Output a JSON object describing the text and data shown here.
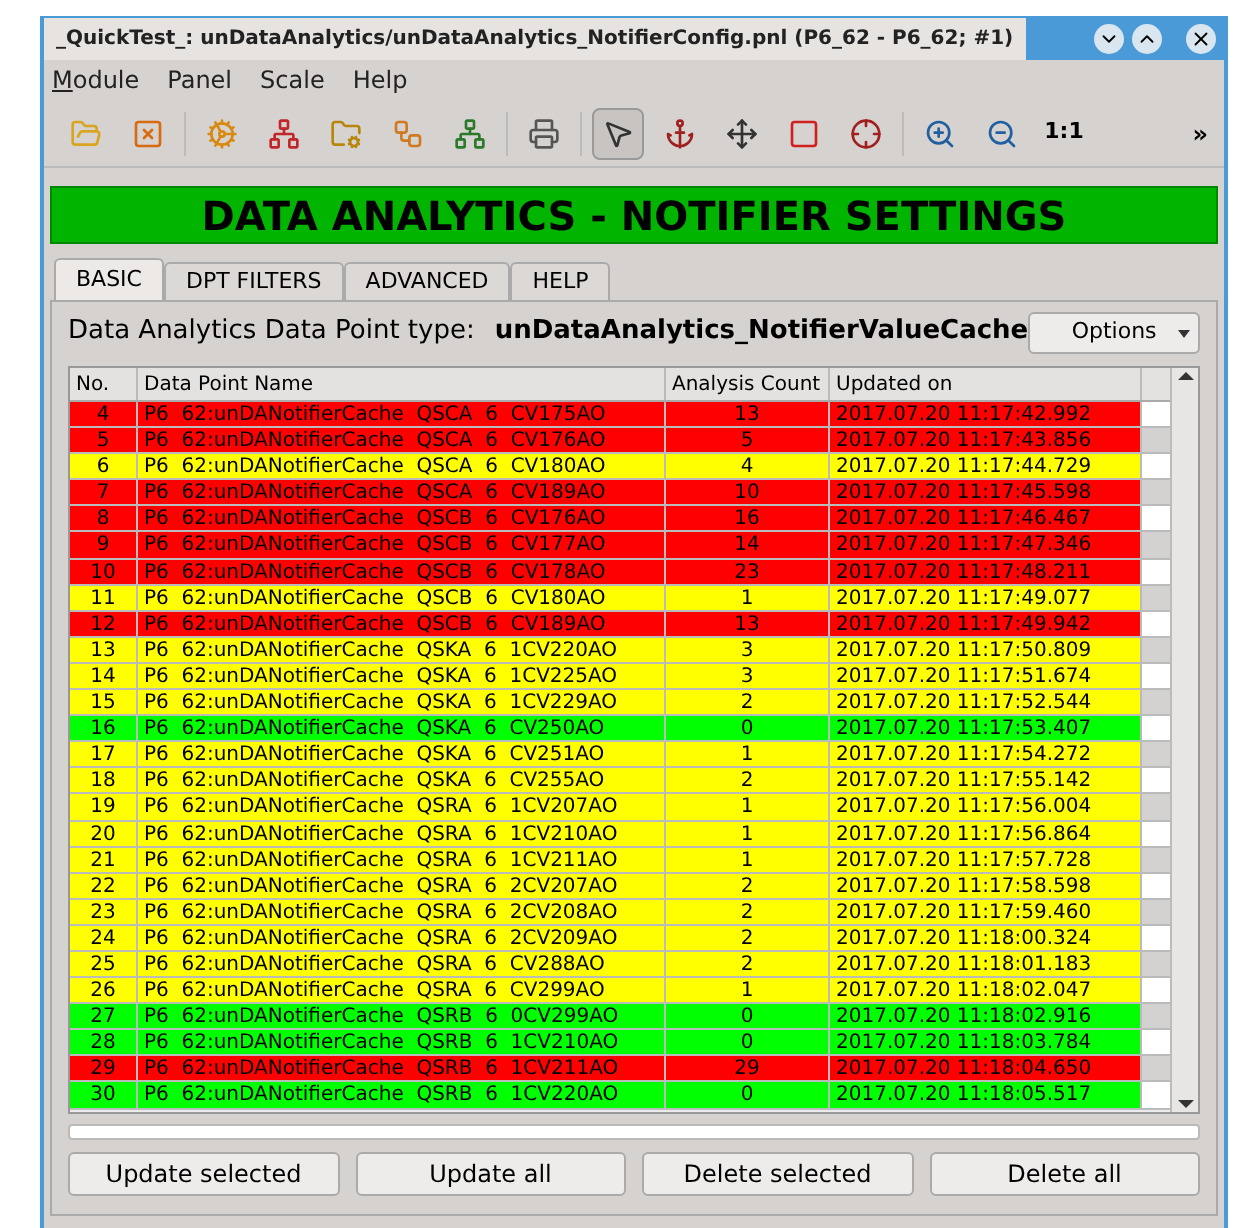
{
  "window": {
    "title": "_QuickTest_: unDataAnalytics/unDataAnalytics_NotifierConfig.pnl (P6_62 - P6_62; #1)"
  },
  "menu": [
    {
      "label": "Module",
      "mnemonic": true
    },
    {
      "label": "Panel",
      "mnemonic": false
    },
    {
      "label": "Scale",
      "mnemonic": false
    },
    {
      "label": "Help",
      "mnemonic": false
    }
  ],
  "toolbar": {
    "tools": [
      {
        "selected": false
      },
      {
        "selected": false
      },
      {
        "selected": false
      },
      {
        "selected": false
      },
      {
        "selected": false
      },
      {
        "selected": false
      },
      {
        "selected": false
      },
      {
        "selected": false
      },
      {
        "selected": true
      },
      {
        "selected": false
      },
      {
        "selected": false
      },
      {
        "selected": false
      },
      {
        "selected": false
      },
      {
        "selected": false
      },
      {
        "selected": false
      },
      {
        "selected": false,
        "label": "1:1"
      }
    ],
    "overflow": "»"
  },
  "banner": "DATA ANALYTICS - NOTIFIER SETTINGS",
  "tabs": [
    {
      "label": "BASIC",
      "selected": true
    },
    {
      "label": "DPT FILTERS",
      "selected": false
    },
    {
      "label": "ADVANCED",
      "selected": false
    },
    {
      "label": "HELP",
      "selected": false
    }
  ],
  "dp_type": {
    "label": "Data Analytics Data Point type:",
    "value": "unDataAnalytics_NotifierValueCache"
  },
  "options_button": "Options",
  "table": {
    "columns": [
      "No.",
      "Data Point Name",
      "Analysis Count",
      "Updated on"
    ],
    "rows": [
      {
        "no": "4",
        "name": "P6  62:unDANotifierCache  QSCA  6  CV175AO",
        "count": "13",
        "updated": "2017.07.20 11:17:42.992",
        "color": "#ff0000"
      },
      {
        "no": "5",
        "name": "P6  62:unDANotifierCache  QSCA  6  CV176AO",
        "count": "5",
        "updated": "2017.07.20 11:17:43.856",
        "color": "#ff0000"
      },
      {
        "no": "6",
        "name": "P6  62:unDANotifierCache  QSCA  6  CV180AO",
        "count": "4",
        "updated": "2017.07.20 11:17:44.729",
        "color": "#ffff00"
      },
      {
        "no": "7",
        "name": "P6  62:unDANotifierCache  QSCA  6  CV189AO",
        "count": "10",
        "updated": "2017.07.20 11:17:45.598",
        "color": "#ff0000"
      },
      {
        "no": "8",
        "name": "P6  62:unDANotifierCache  QSCB  6  CV176AO",
        "count": "16",
        "updated": "2017.07.20 11:17:46.467",
        "color": "#ff0000"
      },
      {
        "no": "9",
        "name": "P6  62:unDANotifierCache  QSCB  6  CV177AO",
        "count": "14",
        "updated": "2017.07.20 11:17:47.346",
        "color": "#ff0000"
      },
      {
        "no": "10",
        "name": "P6  62:unDANotifierCache  QSCB  6  CV178AO",
        "count": "23",
        "updated": "2017.07.20 11:17:48.211",
        "color": "#ff0000"
      },
      {
        "no": "11",
        "name": "P6  62:unDANotifierCache  QSCB  6  CV180AO",
        "count": "1",
        "updated": "2017.07.20 11:17:49.077",
        "color": "#ffff00"
      },
      {
        "no": "12",
        "name": "P6  62:unDANotifierCache  QSCB  6  CV189AO",
        "count": "13",
        "updated": "2017.07.20 11:17:49.942",
        "color": "#ff0000"
      },
      {
        "no": "13",
        "name": "P6  62:unDANotifierCache  QSKA  6  1CV220AO",
        "count": "3",
        "updated": "2017.07.20 11:17:50.809",
        "color": "#ffff00"
      },
      {
        "no": "14",
        "name": "P6  62:unDANotifierCache  QSKA  6  1CV225AO",
        "count": "3",
        "updated": "2017.07.20 11:17:51.674",
        "color": "#ffff00"
      },
      {
        "no": "15",
        "name": "P6  62:unDANotifierCache  QSKA  6  1CV229AO",
        "count": "2",
        "updated": "2017.07.20 11:17:52.544",
        "color": "#ffff00"
      },
      {
        "no": "16",
        "name": "P6  62:unDANotifierCache  QSKA  6  CV250AO",
        "count": "0",
        "updated": "2017.07.20 11:17:53.407",
        "color": "#00ff00"
      },
      {
        "no": "17",
        "name": "P6  62:unDANotifierCache  QSKA  6  CV251AO",
        "count": "1",
        "updated": "2017.07.20 11:17:54.272",
        "color": "#ffff00"
      },
      {
        "no": "18",
        "name": "P6  62:unDANotifierCache  QSKA  6  CV255AO",
        "count": "2",
        "updated": "2017.07.20 11:17:55.142",
        "color": "#ffff00"
      },
      {
        "no": "19",
        "name": "P6  62:unDANotifierCache  QSRA  6  1CV207AO",
        "count": "1",
        "updated": "2017.07.20 11:17:56.004",
        "color": "#ffff00"
      },
      {
        "no": "20",
        "name": "P6  62:unDANotifierCache  QSRA  6  1CV210AO",
        "count": "1",
        "updated": "2017.07.20 11:17:56.864",
        "color": "#ffff00"
      },
      {
        "no": "21",
        "name": "P6  62:unDANotifierCache  QSRA  6  1CV211AO",
        "count": "1",
        "updated": "2017.07.20 11:17:57.728",
        "color": "#ffff00"
      },
      {
        "no": "22",
        "name": "P6  62:unDANotifierCache  QSRA  6  2CV207AO",
        "count": "2",
        "updated": "2017.07.20 11:17:58.598",
        "color": "#ffff00"
      },
      {
        "no": "23",
        "name": "P6  62:unDANotifierCache  QSRA  6  2CV208AO",
        "count": "2",
        "updated": "2017.07.20 11:17:59.460",
        "color": "#ffff00"
      },
      {
        "no": "24",
        "name": "P6  62:unDANotifierCache  QSRA  6  2CV209AO",
        "count": "2",
        "updated": "2017.07.20 11:18:00.324",
        "color": "#ffff00"
      },
      {
        "no": "25",
        "name": "P6  62:unDANotifierCache  QSRA  6  CV288AO",
        "count": "2",
        "updated": "2017.07.20 11:18:01.183",
        "color": "#ffff00"
      },
      {
        "no": "26",
        "name": "P6  62:unDANotifierCache  QSRA  6  CV299AO",
        "count": "1",
        "updated": "2017.07.20 11:18:02.047",
        "color": "#ffff00"
      },
      {
        "no": "27",
        "name": "P6  62:unDANotifierCache  QSRB  6  0CV299AO",
        "count": "0",
        "updated": "2017.07.20 11:18:02.916",
        "color": "#00ff00"
      },
      {
        "no": "28",
        "name": "P6  62:unDANotifierCache  QSRB  6  1CV210AO",
        "count": "0",
        "updated": "2017.07.20 11:18:03.784",
        "color": "#00ff00"
      },
      {
        "no": "29",
        "name": "P6  62:unDANotifierCache  QSRB  6  1CV211AO",
        "count": "29",
        "updated": "2017.07.20 11:18:04.650",
        "color": "#ff0000"
      },
      {
        "no": "30",
        "name": "P6  62:unDANotifierCache  QSRB  6  1CV220AO",
        "count": "0",
        "updated": "2017.07.20 11:18:05.517",
        "color": "#00ff00"
      }
    ]
  },
  "buttons": [
    "Update selected",
    "Update all",
    "Delete selected",
    "Delete all"
  ]
}
